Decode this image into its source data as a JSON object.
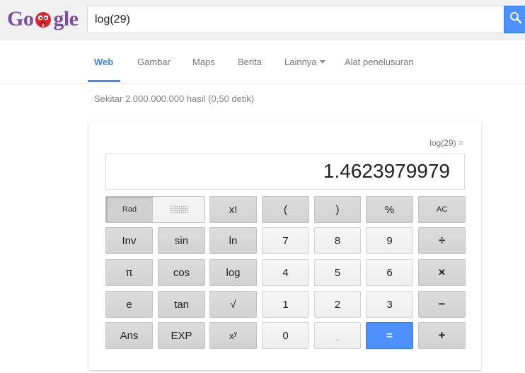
{
  "header": {
    "logo_text": "Google",
    "search_value": "log(29)"
  },
  "tabs": {
    "web": "Web",
    "images": "Gambar",
    "maps": "Maps",
    "news": "Berita",
    "more": "Lainnya",
    "tools": "Alat penelusuran"
  },
  "results": {
    "stats": "Sekitar 2.000.000.000 hasil (0,50 detik)"
  },
  "calculator": {
    "expression": "log(29) =",
    "display_value": "1.4623979979",
    "rad_label": "Rad",
    "keys": {
      "fact": "x!",
      "lparen": "(",
      "rparen": ")",
      "percent": "%",
      "ac": "AC",
      "inv": "Inv",
      "sin": "sin",
      "ln": "ln",
      "seven": "7",
      "eight": "8",
      "nine": "9",
      "divide": "÷",
      "pi": "π",
      "cos": "cos",
      "log": "log",
      "four": "4",
      "five": "5",
      "six": "6",
      "multiply": "×",
      "e": "e",
      "tan": "tan",
      "sqrt": "√",
      "one": "1",
      "two": "2",
      "three": "3",
      "minus": "−",
      "ans": "Ans",
      "exp": "EXP",
      "power_base": "x",
      "power_exp": "y",
      "zero": "0",
      "dot": ".",
      "equals": "=",
      "plus": "+"
    }
  },
  "colors": {
    "accent_blue": "#4285f4",
    "search_button": "#4d90fe",
    "logo_purple": "#7a4f9e"
  }
}
